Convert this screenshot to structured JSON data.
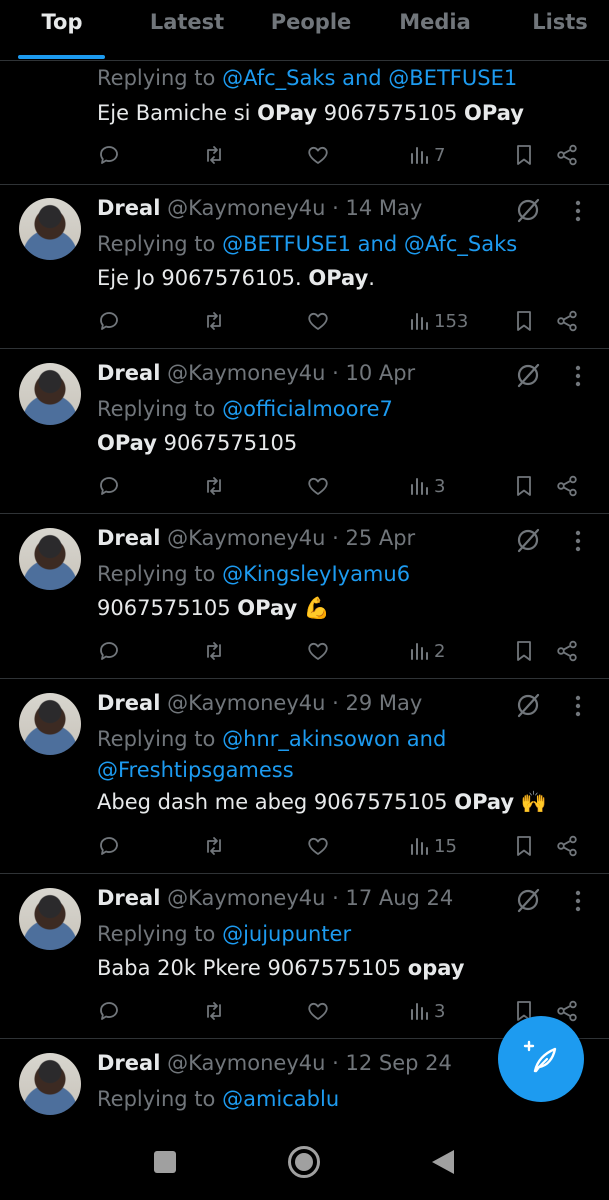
{
  "tabs": [
    {
      "label": "Top",
      "active": true
    },
    {
      "label": "Latest",
      "active": false
    },
    {
      "label": "People",
      "active": false
    },
    {
      "label": "Media",
      "active": false
    },
    {
      "label": "Lists",
      "active": false
    }
  ],
  "tweets": [
    {
      "reply_prefix": "Replying to ",
      "reply_to": "@Afc_Saks and @BETFUSE1",
      "text_a": "Eje Bamiche si ",
      "text_b": "OPay",
      "text_c": " 9067575105 ",
      "text_d": "OPay",
      "text_e": "",
      "views": "7"
    },
    {
      "name": "Dreal",
      "handle": "@Kaymoney4u",
      "sep": " · ",
      "date": "14 May",
      "reply_prefix": "Replying to ",
      "reply_to": "@BETFUSE1 and @Afc_Saks",
      "text_a": "Eje Jo 9067576105. ",
      "text_b": "OPay",
      "text_c": ".",
      "text_d": "",
      "text_e": "",
      "views": "153"
    },
    {
      "name": "Dreal",
      "handle": "@Kaymoney4u",
      "sep": " · ",
      "date": "10 Apr",
      "reply_prefix": "Replying to ",
      "reply_to": "@officialmoore7",
      "text_a": "",
      "text_b": "OPay",
      "text_c": " 9067575105",
      "text_d": "",
      "text_e": "",
      "views": "3"
    },
    {
      "name": "Dreal",
      "handle": "@Kaymoney4u",
      "sep": " · ",
      "date": "25 Apr",
      "reply_prefix": "Replying to ",
      "reply_to": "@KingsleyIyamu6",
      "text_a": "9067575105 ",
      "text_b": "OPay",
      "text_c": " ",
      "text_d": "",
      "text_e": "💪",
      "views": "2"
    },
    {
      "name": "Dreal",
      "handle": "@Kaymoney4u",
      "sep": " · ",
      "date": "29 May",
      "reply_prefix": "Replying to ",
      "reply_to": "@hnr_akinsowon and",
      "reply_to_line2": "@Freshtipsgamess",
      "text_a": "Abeg dash me abeg 9067575105 ",
      "text_b": "OPay",
      "text_c": " ",
      "text_d": "",
      "text_e": "🙌",
      "views": "15"
    },
    {
      "name": "Dreal",
      "handle": "@Kaymoney4u",
      "sep": " · ",
      "date": "17 Aug 24",
      "reply_prefix": "Replying to ",
      "reply_to": "@jujupunter",
      "text_a": "Baba 20k Pkere 9067575105 ",
      "text_b": "opay",
      "text_c": "",
      "text_d": "",
      "text_e": "",
      "views": "3"
    },
    {
      "name": "Dreal",
      "handle": "@Kaymoney4u",
      "sep": " · ",
      "date": "12 Sep 24",
      "reply_prefix": "Replying to ",
      "reply_to": "@amicablu"
    }
  ],
  "icons": {
    "reply": "reply-icon",
    "retweet": "retweet-icon",
    "like": "like-icon",
    "views": "views-icon",
    "bookmark": "bookmark-icon",
    "share": "share-icon",
    "grok": "grok-icon",
    "more": "more-icon",
    "compose": "compose-icon"
  },
  "colors": {
    "accent": "#1d9bf0",
    "background": "#000000",
    "muted": "#71767b",
    "text": "#e7e9ea"
  }
}
